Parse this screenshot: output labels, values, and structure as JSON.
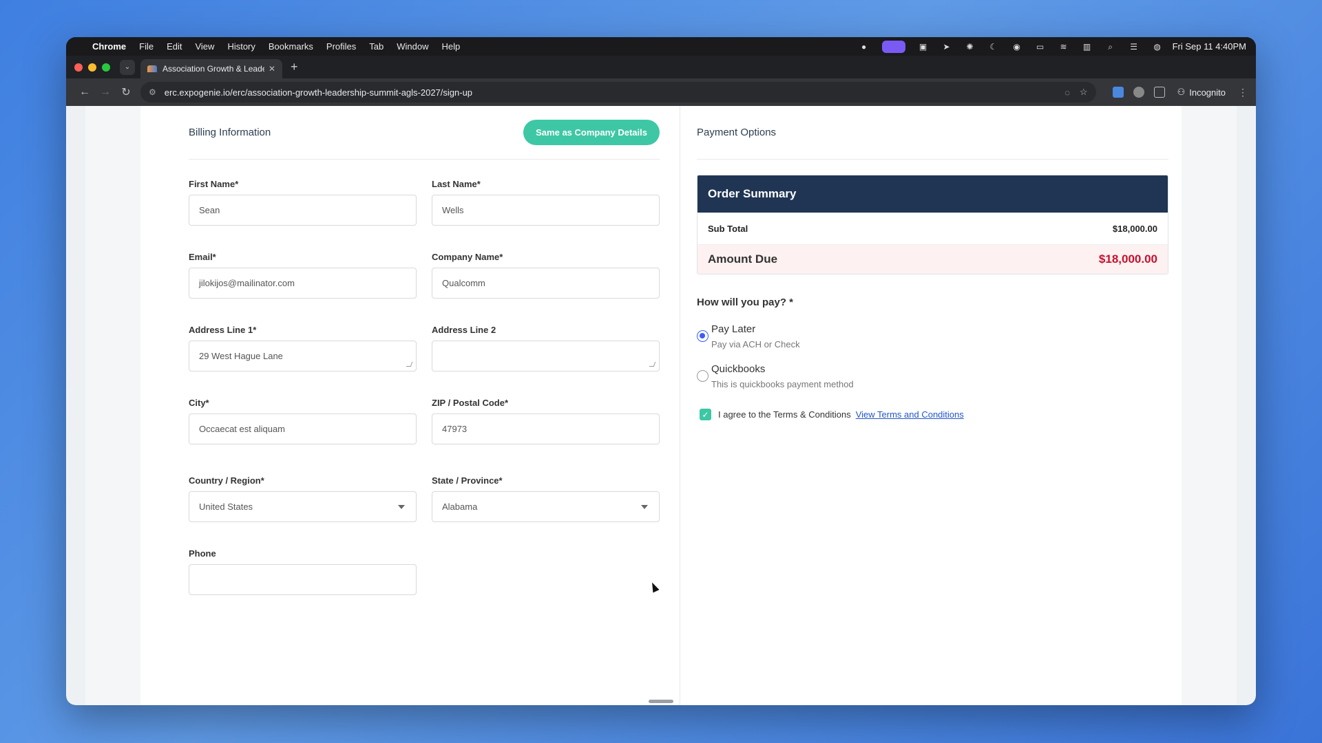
{
  "menubar": {
    "app": "Chrome",
    "items": [
      "File",
      "Edit",
      "View",
      "History",
      "Bookmarks",
      "Profiles",
      "Tab",
      "Window",
      "Help"
    ],
    "clock": "Fri Sep 11  4:40PM"
  },
  "tab": {
    "title": "Association Growth & Leader",
    "close": "✕",
    "new": "+"
  },
  "toolbar": {
    "url": "erc.expogenie.io/erc/association-growth-leadership-summit-agls-2027/sign-up",
    "incognito": "Incognito"
  },
  "billing": {
    "title": "Billing Information",
    "same_button": "Same as Company Details",
    "fields": {
      "first_name": {
        "label": "First Name*",
        "value": "Sean"
      },
      "last_name": {
        "label": "Last Name*",
        "value": "Wells"
      },
      "email": {
        "label": "Email*",
        "value": "jilokijos@mailinator.com"
      },
      "company": {
        "label": "Company Name*",
        "value": "Qualcomm"
      },
      "address1": {
        "label": "Address Line 1*",
        "value": "29 West Hague Lane"
      },
      "address2": {
        "label": "Address Line 2",
        "value": ""
      },
      "city": {
        "label": "City*",
        "value": "Occaecat est aliquam"
      },
      "zip": {
        "label": "ZIP / Postal Code*",
        "value": "47973"
      },
      "country": {
        "label": "Country / Region*",
        "value": "United States"
      },
      "state": {
        "label": "State / Province*",
        "value": "Alabama"
      },
      "phone": {
        "label": "Phone",
        "value": ""
      }
    }
  },
  "payment": {
    "title": "Payment Options",
    "order_summary": "Order Summary",
    "subtotal_label": "Sub Total",
    "subtotal_value": "$18,000.00",
    "amount_due_label": "Amount Due",
    "amount_due_value": "$18,000.00",
    "question": "How will you pay? *",
    "options": [
      {
        "title": "Pay Later",
        "desc": "Pay via ACH or Check",
        "selected": true
      },
      {
        "title": "Quickbooks",
        "desc": "This is quickbooks payment method",
        "selected": false
      }
    ],
    "terms_text": "I agree to the Terms & Conditions",
    "terms_link": "View Terms and Conditions",
    "terms_checked": true
  },
  "colors": {
    "accent": "#3ec7a4",
    "navy": "#1f3553",
    "due_red": "#c8102e",
    "radio_blue": "#3d5afe"
  }
}
